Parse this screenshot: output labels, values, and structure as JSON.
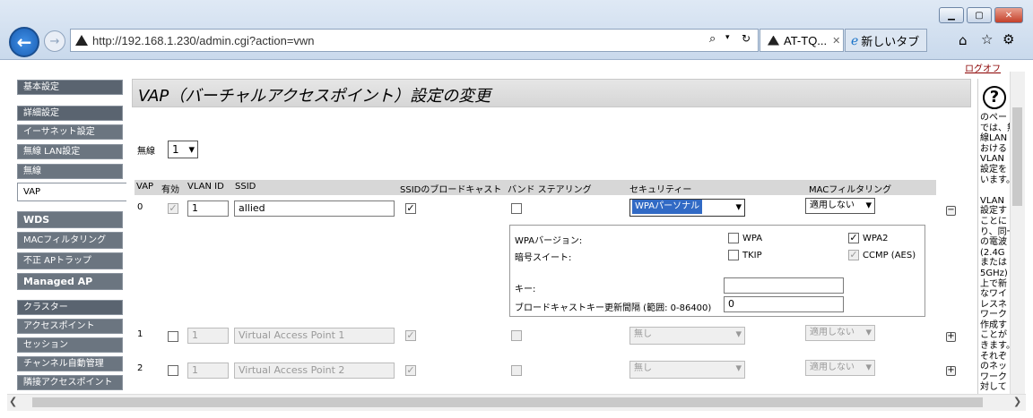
{
  "browser": {
    "url": "http://192.168.1.230/admin.cgi?action=vwn",
    "tabs": [
      {
        "label": "AT-TQ..."
      },
      {
        "label": "新しいタブ"
      }
    ],
    "close_glyph": "✕"
  },
  "page": {
    "logout": "ログオフ",
    "title": "VAP（バーチャルアクセスポイント）設定の変更",
    "radio_label": "無線",
    "radio_value": "1"
  },
  "sidebar": {
    "items": [
      {
        "label": "基本設定"
      },
      {
        "label": "詳細設定"
      },
      {
        "label": "イーサネット設定"
      },
      {
        "label": "無線 LAN設定"
      },
      {
        "label": "無線"
      },
      {
        "label": "VAP"
      },
      {
        "label": "WDS"
      },
      {
        "label": "MACフィルタリング"
      },
      {
        "label": "不正 APトラップ"
      },
      {
        "label": "Managed AP"
      },
      {
        "label": "クラスター"
      },
      {
        "label": "アクセスポイント"
      },
      {
        "label": "セッション"
      },
      {
        "label": "チャンネル自動管理"
      },
      {
        "label": "隣接アクセスポイント"
      }
    ]
  },
  "table": {
    "headers": [
      "VAP",
      "有効",
      "VLAN ID",
      "SSID",
      "SSIDのブロードキャスト",
      "バンド ステアリング",
      "セキュリティー",
      "MACフィルタリング"
    ],
    "rows": [
      {
        "vap": "0",
        "vlan": "1",
        "ssid": "allied",
        "security": "WPAパーソナル",
        "mac_filter": "適用しない"
      },
      {
        "vap": "1",
        "vlan": "1",
        "ssid": "Virtual Access Point 1",
        "security": "無し",
        "mac_filter": "適用しない"
      },
      {
        "vap": "2",
        "vlan": "1",
        "ssid": "Virtual Access Point 2",
        "security": "無し",
        "mac_filter": "適用しない"
      }
    ]
  },
  "wpa": {
    "version_label": "WPAバージョン:",
    "wpa": "WPA",
    "wpa2": "WPA2",
    "cipher_label": "暗号スイート:",
    "tkip": "TKIP",
    "ccmp": "CCMP (AES)",
    "key_label": "キー:",
    "key_value": "",
    "interval_label": "ブロードキャストキー更新間隔 (範囲: 0-86400)",
    "interval_value": "0"
  },
  "help": {
    "icon_glyph": "?",
    "lines": [
      "のペー",
      "では、無",
      "線LAN",
      "おける",
      "VLAN",
      "設定を",
      "います。",
      "",
      "VLAN",
      "設定す",
      "ことに",
      "り、同一",
      "の電波",
      "(2.4G",
      "または",
      "5GHz)",
      "上で新",
      "なワイ",
      "レスネ",
      "ワーク",
      "作成す",
      "ことが",
      "きます。",
      "それぞ",
      "のネッ",
      "ワーク",
      "対して"
    ]
  },
  "icons": {
    "check": "✓",
    "chevron_down": "▾",
    "minus": "−",
    "plus": "+",
    "arrow_left": "❮",
    "arrow_right": "❯"
  }
}
